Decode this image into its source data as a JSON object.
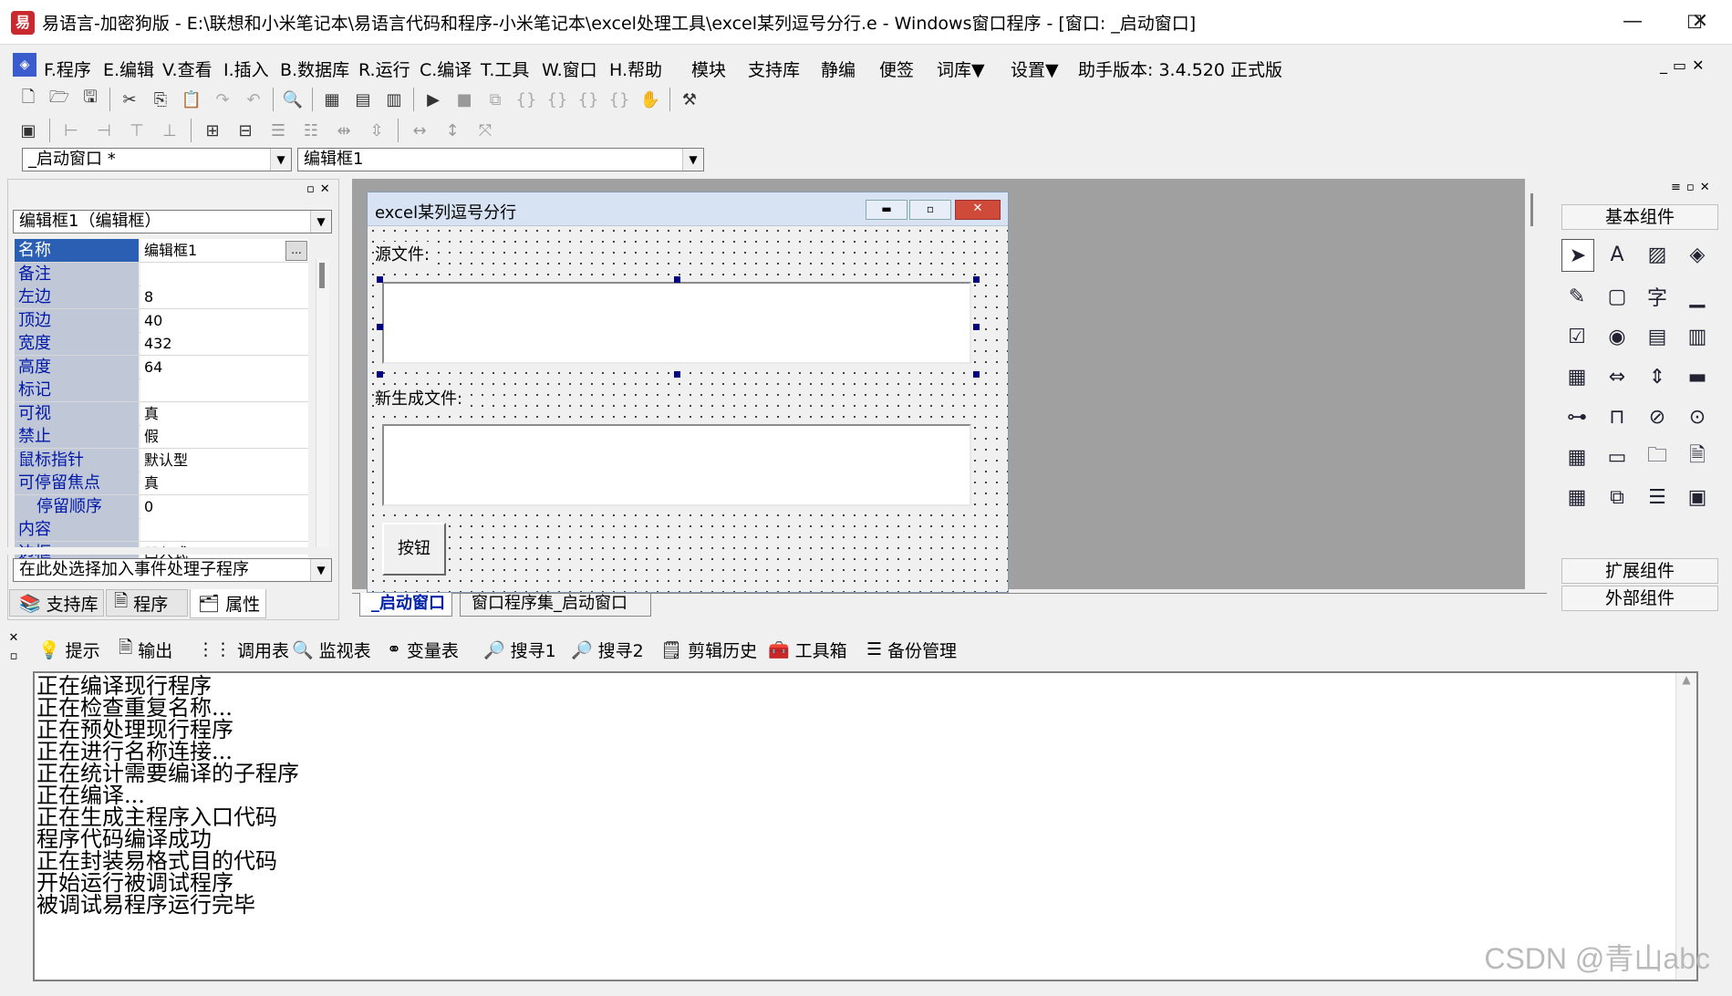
{
  "window": {
    "title": "易语言-加密狗版 - E:\\联想和小米笔记本\\易语言代码和程序-小米笔记本\\excel处理工具\\excel某列逗号分行.e - Windows窗口程序 - [窗口: _启动窗口]",
    "app_icon": "易",
    "min": "—",
    "max": "☐",
    "close": "✕"
  },
  "menu": {
    "items": [
      "F.程序",
      "E.编辑",
      "V.查看",
      "I.插入",
      "B.数据库",
      "R.运行",
      "C.编译",
      "T.工具",
      "W.窗口",
      "H.帮助"
    ],
    "extras": [
      "模块",
      "支持库",
      "静编",
      "便签",
      "词库▼",
      "设置▼"
    ],
    "version": "助手版本: 3.4.520 正式版"
  },
  "selectors": {
    "window_combo": "_启动窗口 *",
    "control_combo": "编辑框1"
  },
  "props": {
    "object_combo": "编辑框1（编辑框）",
    "rows": [
      {
        "name": "名称",
        "value": "编辑框1"
      },
      {
        "name": "备注",
        "value": ""
      },
      {
        "name": "左边",
        "value": "8"
      },
      {
        "name": "顶边",
        "value": "40"
      },
      {
        "name": "宽度",
        "value": "432"
      },
      {
        "name": "高度",
        "value": "64"
      },
      {
        "name": "标记",
        "value": ""
      },
      {
        "name": "可视",
        "value": "真"
      },
      {
        "name": "禁止",
        "value": "假"
      },
      {
        "name": "鼠标指针",
        "value": "默认型"
      },
      {
        "name": "可停留焦点",
        "value": "真"
      },
      {
        "name": "停留顺序",
        "value": "0"
      },
      {
        "name": "内容",
        "value": ""
      },
      {
        "name": "边框",
        "value": "凹入式"
      }
    ],
    "event_combo": "在此处选择加入事件处理子程序"
  },
  "left_tabs": [
    "支持库",
    "程序",
    "属性"
  ],
  "form": {
    "title": "excel某列逗号分行",
    "source_label": "源文件:",
    "new_label": "新生成文件:",
    "button_label": "按钮"
  },
  "design_tabs": [
    "_启动窗口",
    "窗口程序集_启动窗口"
  ],
  "right_panel": {
    "basic": "基本组件",
    "expand": "扩展组件",
    "external": "外部组件",
    "char_icon": "字"
  },
  "bottom_tabs": [
    "提示",
    "输出",
    "调用表",
    "监视表",
    "变量表",
    "搜寻1",
    "搜寻2",
    "剪辑历史",
    "工具箱",
    "备份管理"
  ],
  "output_lines": [
    "正在编译现行程序",
    "正在检查重复名称...",
    "正在预处理现行程序",
    "正在进行名称连接...",
    "正在统计需要编译的子程序",
    "正在编译...",
    "正在生成主程序入口代码",
    "程序代码编译成功",
    "正在封装易格式目的代码",
    "开始运行被调试程序",
    "被调试易程序运行完毕"
  ],
  "watermark": "CSDN @青山abc"
}
